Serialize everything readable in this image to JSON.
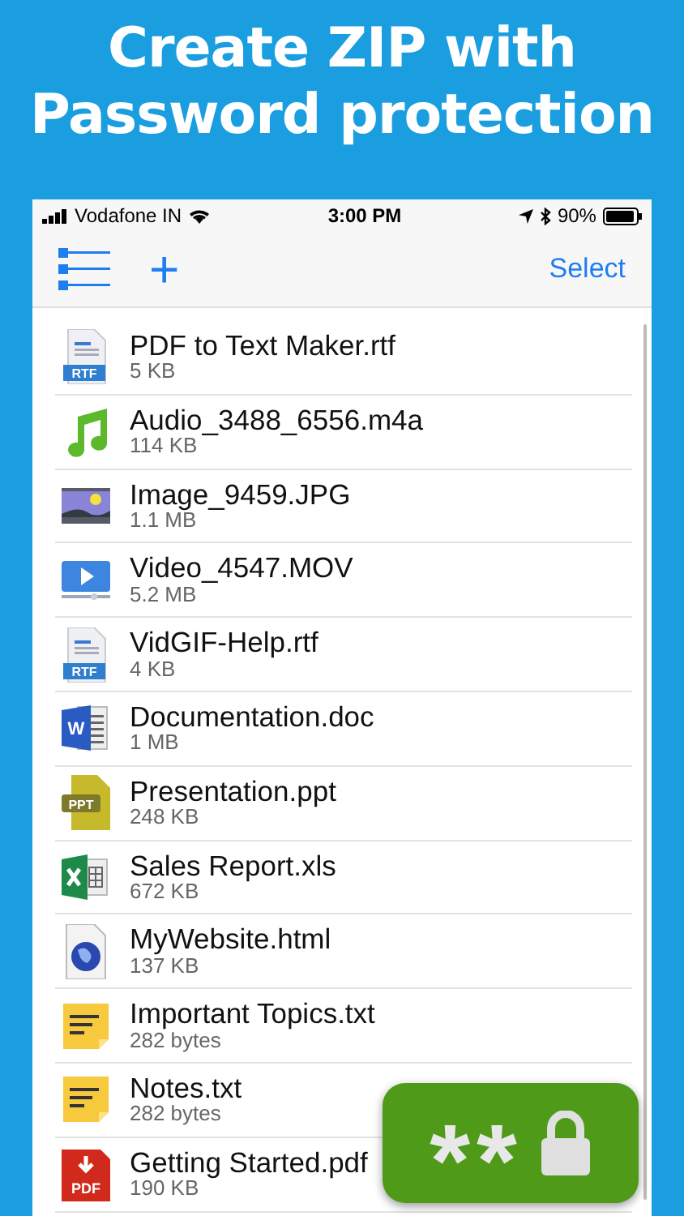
{
  "headline": [
    "Create ZIP with",
    "Password protection"
  ],
  "status_bar": {
    "carrier": "Vodafone IN",
    "time": "3:00 PM",
    "battery": "90%"
  },
  "nav_bar": {
    "add": "+",
    "select": "Select"
  },
  "files": [
    {
      "name": "PDF to Text Maker.rtf",
      "size": "5 KB",
      "kind": "rtf",
      "icon_label": "RTF"
    },
    {
      "name": "Audio_3488_6556.m4a",
      "size": "114 KB",
      "kind": "audio"
    },
    {
      "name": "Image_9459.JPG",
      "size": "1.1 MB",
      "kind": "image"
    },
    {
      "name": "Video_4547.MOV",
      "size": "5.2 MB",
      "kind": "video"
    },
    {
      "name": "VidGIF-Help.rtf",
      "size": "4 KB",
      "kind": "rtf",
      "icon_label": "RTF"
    },
    {
      "name": "Documentation.doc",
      "size": "1 MB",
      "kind": "doc",
      "icon_label": "W"
    },
    {
      "name": "Presentation.ppt",
      "size": "248 KB",
      "kind": "ppt",
      "icon_label": "PPT"
    },
    {
      "name": "Sales Report.xls",
      "size": "672 KB",
      "kind": "xls"
    },
    {
      "name": "MyWebsite.html",
      "size": "137 KB",
      "kind": "html"
    },
    {
      "name": "Important Topics.txt",
      "size": "282 bytes",
      "kind": "txt"
    },
    {
      "name": "Notes.txt",
      "size": "282 bytes",
      "kind": "txt"
    },
    {
      "name": "Getting Started.pdf",
      "size": "190 KB",
      "kind": "pdf",
      "icon_label": "PDF"
    }
  ],
  "badge": {
    "text": "**"
  }
}
